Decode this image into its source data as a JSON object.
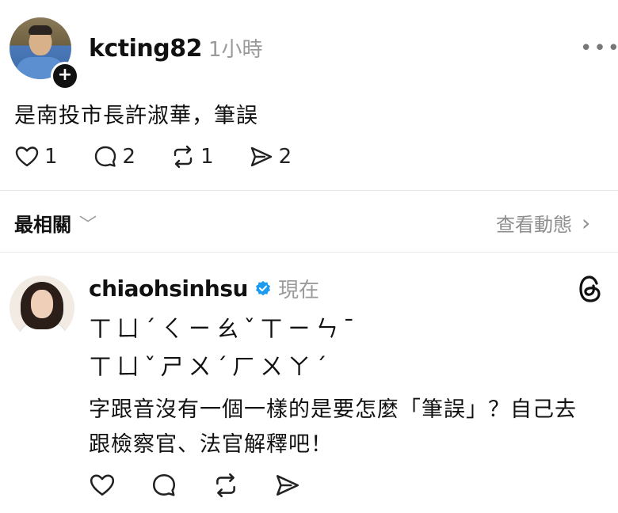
{
  "post1": {
    "username": "kcting82",
    "time": "1小時",
    "more": "•••",
    "text": "是南投市長許淑華，筆誤",
    "actions": {
      "likes": "1",
      "replies": "2",
      "reposts": "1",
      "shares": "2"
    }
  },
  "section": {
    "title": "最相關",
    "chevron": "﹀",
    "view_activity": "查看動態",
    "view_chevron": "›"
  },
  "post2": {
    "username": "chiaohsinhsu",
    "time": "現在",
    "bopomofo_line1": "ㄒㄩˊㄑㄧㄠˇㄒㄧㄣˉ",
    "bopomofo_line2": "ㄒㄩˇㄕㄨˊㄏㄨㄚˊ",
    "body_line1": "字跟音沒有一個一樣的是要怎麼「筆誤」？自己去",
    "body_line2": "跟檢察官、法官解釋吧！"
  },
  "icons": {
    "avatar_plus": "plus-icon",
    "verified": "verified-badge-icon",
    "threads": "threads-logo-icon",
    "like": "heart-icon",
    "reply": "comment-icon",
    "repost": "repost-icon",
    "share": "send-icon"
  },
  "colors": {
    "verified": "#1d9bf0",
    "muted": "#9a9a9a"
  }
}
